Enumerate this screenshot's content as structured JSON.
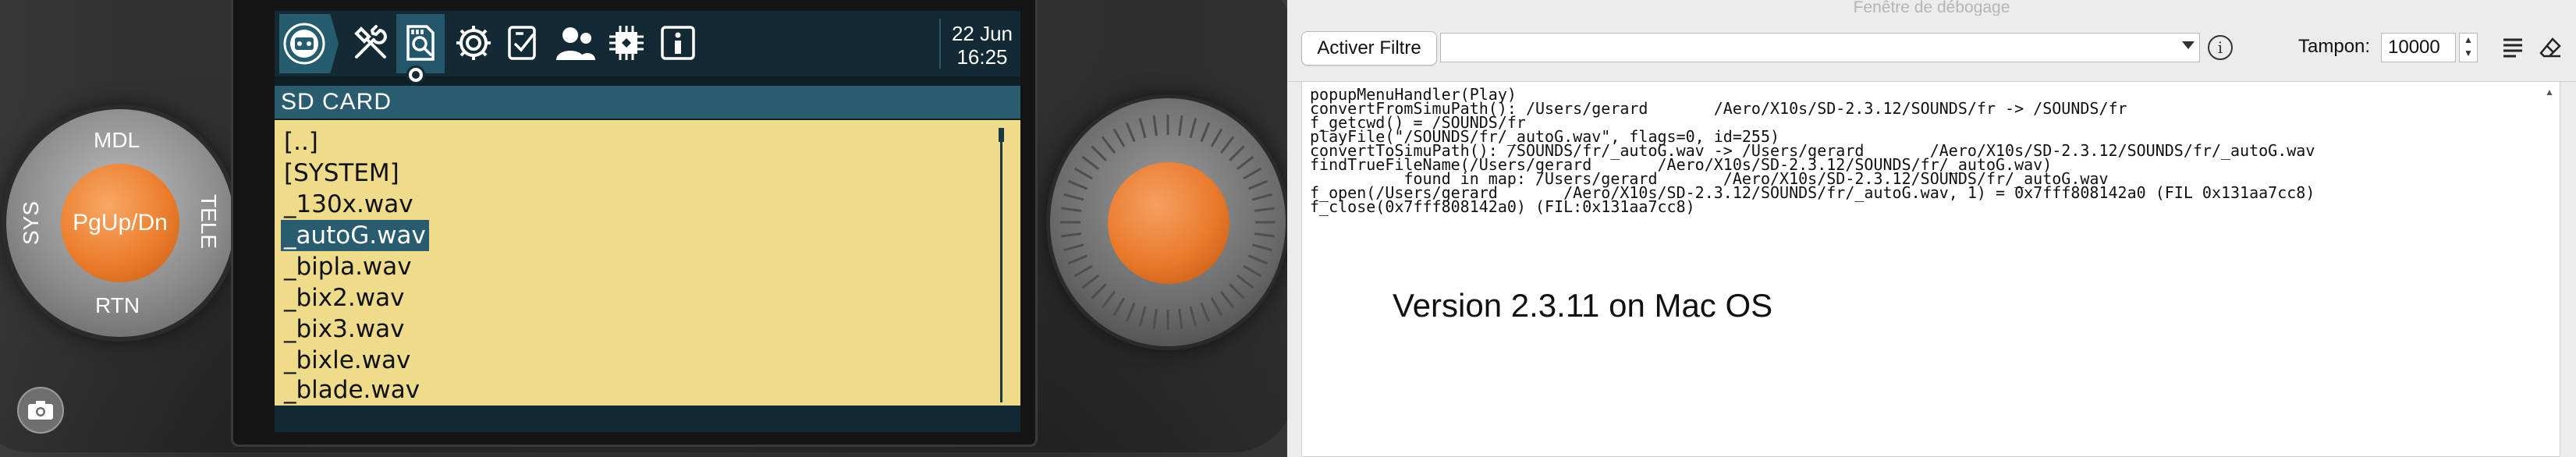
{
  "simulator": {
    "left_dial": {
      "top": "MDL",
      "bottom": "RTN",
      "left": "SYS",
      "right": "TELE",
      "center": "PgUp/Dn"
    },
    "topbar": {
      "icons": [
        "radio-setup-icon",
        "model-tools-icon",
        "sd-card-browser-icon",
        "settings-gear-icon",
        "checklist-icon",
        "user-icon",
        "hardware-chip-icon",
        "info-icon"
      ],
      "date": "22 Jun",
      "time": "16:25"
    },
    "screen_title": "SD CARD",
    "files": [
      "[..]",
      "[SYSTEM]",
      "_130x.wav",
      "_autoG.wav",
      "_bipla.wav",
      "_bix2.wav",
      "_bix3.wav",
      "_bixle.wav",
      "_blade.wav"
    ],
    "selected_file": "_autoG.wav",
    "colors": {
      "screen_bg": "#132a34",
      "title_bar": "#285c6e",
      "file_bg": "#eedc8a",
      "knob": "#ea7a2b"
    }
  },
  "debug_window": {
    "title": "Fenêtre de débogage",
    "filter_button": "Activer Filtre",
    "filter_value": "",
    "buffer_label": "Tampon:",
    "buffer_value": "10000",
    "log_lines": [
      "popupMenuHandler(Play)",
      "convertFromSimuPath(): /Users/gerard       /Aero/X10s/SD-2.3.12/SOUNDS/fr -> /SOUNDS/fr",
      "f_getcwd() = /SOUNDS/fr",
      "playFile(\"/SOUNDS/fr/_autoG.wav\", flags=0, id=255)",
      "convertToSimuPath(): /SOUNDS/fr/_autoG.wav -> /Users/gerard       /Aero/X10s/SD-2.3.12/SOUNDS/fr/_autoG.wav",
      "findTrueFileName(/Users/gerard       /Aero/X10s/SD-2.3.12/SOUNDS/fr/_autoG.wav)",
      "          found in map: /Users/gerard       /Aero/X10s/SD-2.3.12/SOUNDS/fr/_autoG.wav",
      "f_open(/Users/gerard       /Aero/X10s/SD-2.3.12/SOUNDS/fr/_autoG.wav, 1) = 0x7fff808142a0 (FIL 0x131aa7cc8)",
      "f_close(0x7fff808142a0) (FIL:0x131aa7cc8)"
    ],
    "annotation": "Version 2.3.11 on Mac OS"
  }
}
